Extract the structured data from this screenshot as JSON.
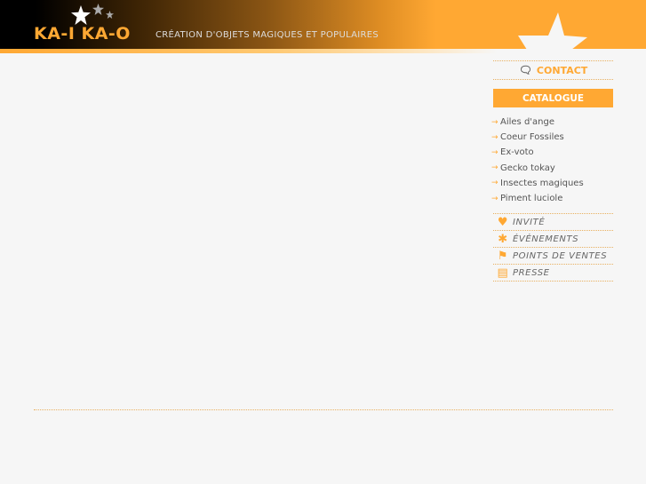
{
  "header": {
    "logo": "KA-I KA-O",
    "tagline": "Création d'objets magiques et populaires"
  },
  "sidebar": {
    "contact": "Contact",
    "catalogue": "Catalogue",
    "catalogue_items": [
      "Ailes d'ange",
      "Coeur Fossiles",
      "Ex-voto",
      "Gecko tokay",
      "Insectes magiques",
      "Piment luciole"
    ],
    "nav": [
      {
        "label": "Invité",
        "icon": "heart-icon"
      },
      {
        "label": "Événements",
        "icon": "asterisk-icon"
      },
      {
        "label": "Points de ventes",
        "icon": "flag-icon"
      },
      {
        "label": "Presse",
        "icon": "document-icon"
      }
    ]
  },
  "colors": {
    "accent": "#ffa833"
  }
}
